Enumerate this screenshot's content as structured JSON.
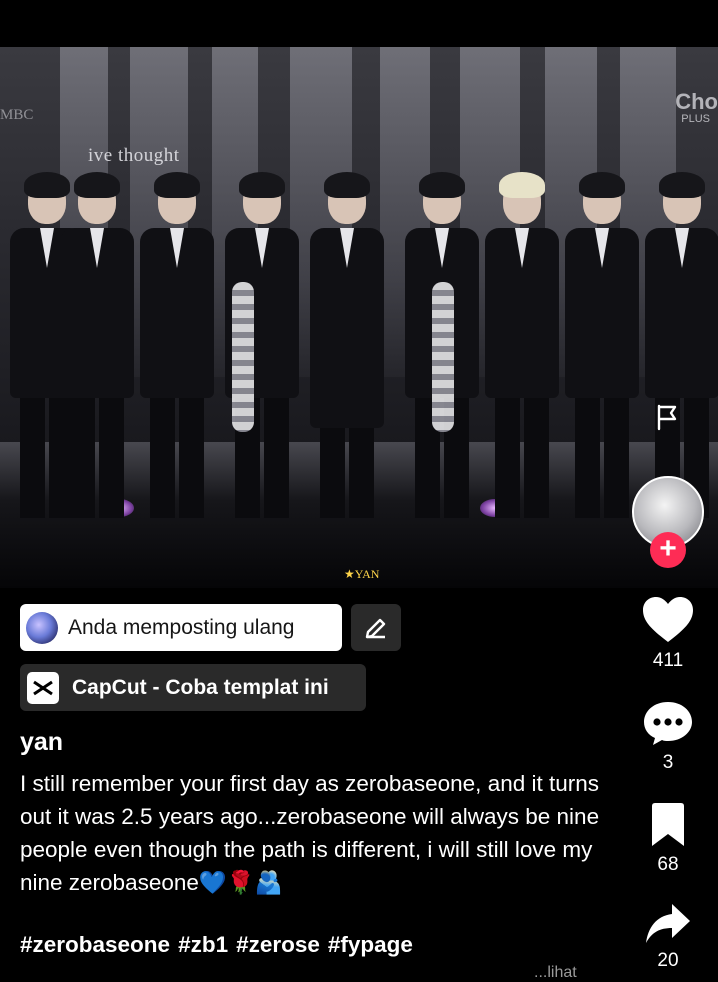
{
  "video": {
    "overlay_caption": "ive thought",
    "overlay_brand": "MBC",
    "overlay_logo": "Cho",
    "overlay_logo_sub": "PLUS",
    "watermark": "★YAN"
  },
  "actions": {
    "like_count": "411",
    "comment_count": "3",
    "bookmark_count": "68",
    "share_count": "20",
    "follow_symbol": "+"
  },
  "repost": {
    "label": "Anda memposting ulang"
  },
  "capcut": {
    "label": "CapCut - Coba templat ini"
  },
  "post": {
    "username": "yan",
    "caption": "I still remember your first day as zerobaseone, and it turns out it was 2.5 years ago...zerobaseone will always be nine people even though the path is different, i will still love my nine zerobaseone💙🌹🫂",
    "hashtags": [
      "#zerobaseone",
      "#zb1",
      "#zerose",
      "#fypage"
    ],
    "peek_text": "...lihat"
  },
  "colors": {
    "follow": "#fe2c55",
    "pill_dark": "#2a2a2a",
    "watermark": "#ffd54a"
  }
}
